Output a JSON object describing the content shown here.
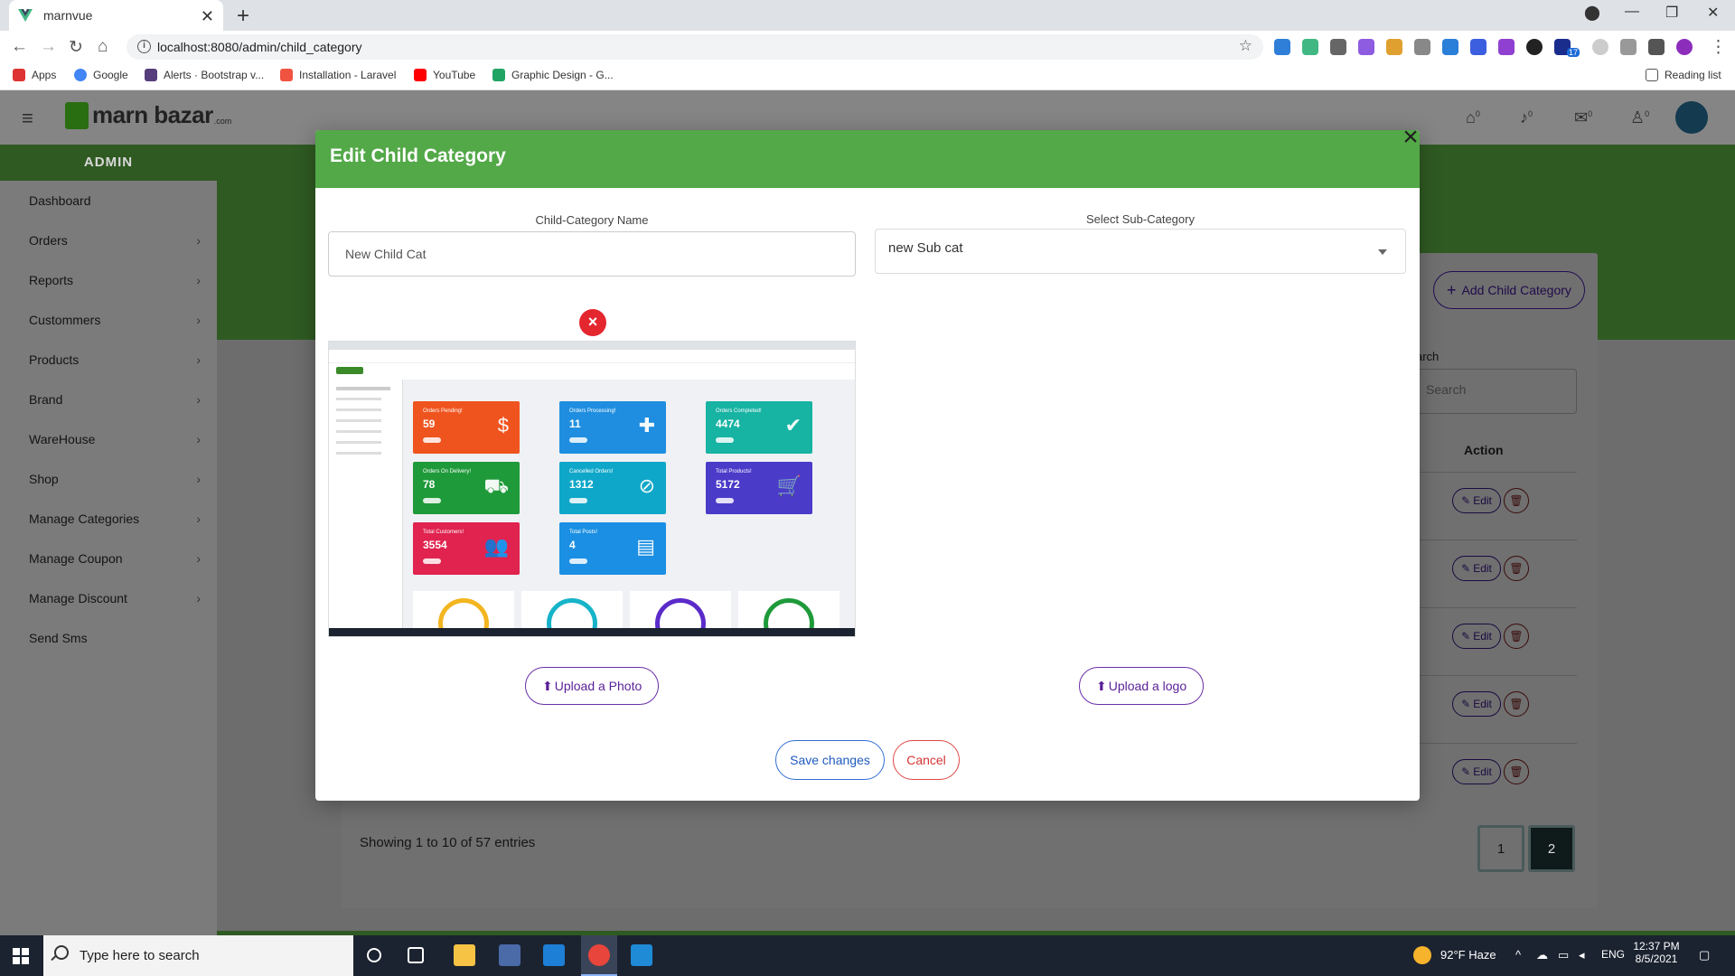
{
  "browser": {
    "tab_title": "marnvue",
    "url": "localhost:8080/admin/child_category",
    "bookmarks": [
      "Apps",
      "Google",
      "Alerts · Bootstrap v...",
      "Installation - Laravel",
      "YouTube",
      "Graphic Design - G..."
    ],
    "reading_list": "Reading list",
    "extension_badge": "17"
  },
  "app": {
    "brand": "marn bazar",
    "brand_suffix": ".com",
    "header_counts": [
      "0",
      "0",
      "0",
      "0"
    ],
    "sidebar": {
      "heading": "ADMIN",
      "items": [
        {
          "label": "Dashboard",
          "has_children": false
        },
        {
          "label": "Orders",
          "has_children": true
        },
        {
          "label": "Reports",
          "has_children": true
        },
        {
          "label": "Custommers",
          "has_children": true
        },
        {
          "label": "Products",
          "has_children": true
        },
        {
          "label": "Brand",
          "has_children": true
        },
        {
          "label": "WareHouse",
          "has_children": true
        },
        {
          "label": "Shop",
          "has_children": true
        },
        {
          "label": "Manage Categories",
          "has_children": true
        },
        {
          "label": "Manage Coupon",
          "has_children": true
        },
        {
          "label": "Manage Discount",
          "has_children": true
        },
        {
          "label": "Send Sms",
          "has_children": false
        }
      ]
    },
    "content": {
      "add_button": "Add Child Category",
      "search_label": "arch",
      "search_placeholder": "Search",
      "action_header": "Action",
      "edit_label": "Edit",
      "row_count": 5,
      "showing": "Showing 1 to 10 of 57 entries",
      "pages": [
        "1",
        "2"
      ]
    }
  },
  "modal": {
    "title": "Edit Child Category",
    "name_label": "Child-Category Name",
    "name_value": "New Child Cat",
    "sub_label": "Select Sub-Category",
    "sub_value": "new Sub cat",
    "upload_photo": "Upload a Photo",
    "upload_logo": "Upload a logo",
    "save": "Save changes",
    "cancel": "Cancel",
    "preview_tiles": [
      {
        "label": "Orders Pending!",
        "value": "59",
        "color": "#f0541e"
      },
      {
        "label": "Orders Processing!",
        "value": "11",
        "color": "#1f8ee0"
      },
      {
        "label": "Orders Completed!",
        "value": "4474",
        "color": "#17b3a3"
      },
      {
        "label": "Orders On Delivery!",
        "value": "78",
        "color": "#1f9a3a"
      },
      {
        "label": "Cancelled Orders!",
        "value": "1312",
        "color": "#0fa7c9"
      },
      {
        "label": "Total Products!",
        "value": "5172",
        "color": "#4b3bc9"
      },
      {
        "label": "Total Customers!",
        "value": "3554",
        "color": "#e0234f"
      },
      {
        "label": "Total Posts!",
        "value": "4",
        "color": "#1a8fe3"
      }
    ]
  },
  "taskbar": {
    "search_placeholder": "Type here to search",
    "weather": "92°F  Haze",
    "lang": "ENG",
    "time": "12:37 PM",
    "date": "8/5/2021"
  }
}
